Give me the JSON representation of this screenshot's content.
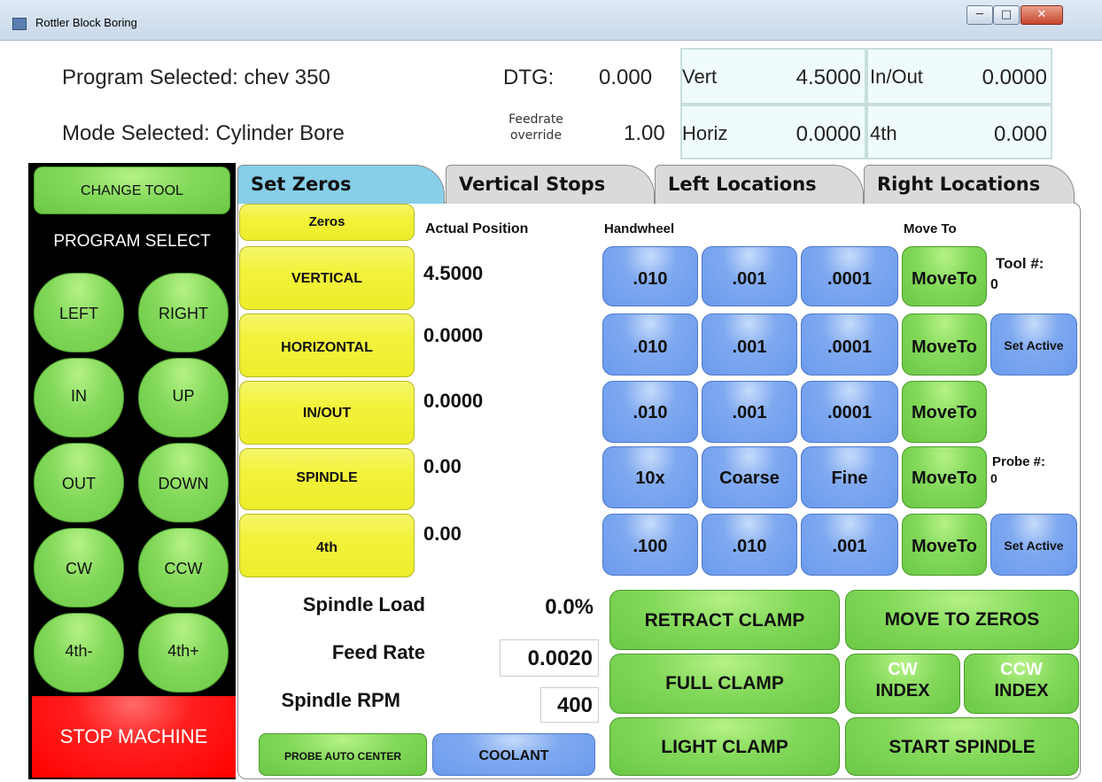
{
  "window": {
    "title": "Rottler Block Boring",
    "controls": {
      "minimize": "─",
      "maximize": "□",
      "close": "✕"
    }
  },
  "header": {
    "program_selected": "Program Selected: chev 350",
    "mode_selected": "Mode Selected: Cylinder Bore",
    "dtg_label": "DTG:",
    "dtg_value": "0.000",
    "feedrate_label": "Feedrate override",
    "feedrate_value": "1.00",
    "axes": {
      "vert": {
        "label": "Vert",
        "value": "4.5000"
      },
      "horiz": {
        "label": "Horiz",
        "value": "0.0000"
      },
      "inout": {
        "label": "In/Out",
        "value": "0.0000"
      },
      "fourth": {
        "label": "4th",
        "value": "0.000"
      }
    }
  },
  "left_panel": {
    "change_tool": "CHANGE TOOL",
    "program_select": "PROGRAM SELECT",
    "jog_buttons": [
      "LEFT",
      "RIGHT",
      "IN",
      "UP",
      "OUT",
      "DOWN",
      "CW",
      "CCW",
      "4th-",
      "4th+"
    ],
    "stop_machine": "STOP MACHINE"
  },
  "tabs": [
    "Set Zeros",
    "Vertical Stops",
    "Left Locations",
    "Right Locations"
  ],
  "active_tab": "Set Zeros",
  "set_zeros": {
    "zeros_button": "Zeros",
    "actual_position_header": "Actual Position",
    "handwheel_header": "Handwheel",
    "move_to_header": "Move To",
    "rows": [
      {
        "axis": "VERTICAL",
        "position": "4.5000",
        "handwheel": [
          ".010",
          ".001",
          ".0001"
        ],
        "move": "MoveTo"
      },
      {
        "axis": "HORIZONTAL",
        "position": "0.0000",
        "handwheel": [
          ".010",
          ".001",
          ".0001"
        ],
        "move": "MoveTo"
      },
      {
        "axis": "IN/OUT",
        "position": "0.0000",
        "handwheel": [
          ".010",
          ".001",
          ".0001"
        ],
        "move": "MoveTo"
      },
      {
        "axis": "SPINDLE",
        "position": "0.00",
        "handwheel": [
          "10x",
          "Coarse",
          "Fine"
        ],
        "move": "MoveTo"
      },
      {
        "axis": "4th",
        "position": "0.00",
        "handwheel": [
          ".100",
          ".010",
          ".001"
        ],
        "move": "MoveTo"
      }
    ],
    "tool_label": "Tool #:",
    "tool_value": "0",
    "probe_label": "Probe #:",
    "probe_value": "0",
    "set_active": "Set Active"
  },
  "status": {
    "spindle_load_label": "Spindle Load",
    "spindle_load_value": "0.0%",
    "feed_rate_label": "Feed Rate",
    "feed_rate_value": "0.0020",
    "spindle_rpm_label": "Spindle RPM",
    "spindle_rpm_value": "400"
  },
  "actions": {
    "probe_auto_center": "PROBE AUTO CENTER",
    "coolant": "COOLANT",
    "retract_clamp": "RETRACT CLAMP",
    "full_clamp": "FULL CLAMP",
    "light_clamp": "LIGHT CLAMP",
    "move_to_zeros": "MOVE TO ZEROS",
    "cw_index_top": "CW",
    "cw_index_bottom": "INDEX",
    "ccw_index_top": "CCW",
    "ccw_index_bottom": "INDEX",
    "start_spindle": "START SPINDLE"
  },
  "colors": {
    "green": "#83d95a",
    "yellow": "#f2f23a",
    "blue": "#7fa9f0",
    "red": "#ff0000",
    "active_tab": "#87cee8"
  }
}
